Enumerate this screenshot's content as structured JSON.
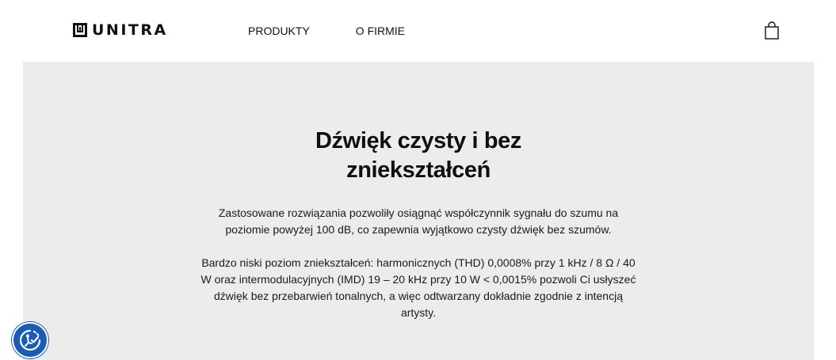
{
  "header": {
    "logo_text": "UNITRA",
    "nav": [
      {
        "label": "PRODUKTY"
      },
      {
        "label": "O FIRMIE"
      }
    ]
  },
  "section": {
    "title_line1": "Dźwięk czysty i bez",
    "title_line2": "zniekształceń",
    "para1_line1": "Zastosowane rozwiązania pozwoliły osiągnąć współczynnik sygnału do szumu na",
    "para1_line2": "poziomie powyżej 100 dB, co zapewnia wyjątkowo czysty dźwięk bez szumów.",
    "para2_line1": "Bardzo niski poziom zniekształceń: harmonicznych (THD) 0,0008% przy 1 kHz / 8 Ω / 40",
    "para2_line2": "W oraz intermodulacyjnych (IMD) 19 – 20 kHz przy 10 W < 0,0015% pozwoli Ci usłyszeć",
    "para2_line3": "dźwięk bez przebarwień tonalnych, a więc odtwarzany dokładnie zgodnie z intencją",
    "para2_line4": "artysty."
  },
  "icons": {
    "logo": "unitra-logo-mark",
    "cart": "shopping-bag-icon",
    "accessibility": "accessibility-icon"
  },
  "colors": {
    "panel_bg": "#ecedeb",
    "text": "#111111",
    "accessibility_bg": "#1a5bb5"
  }
}
